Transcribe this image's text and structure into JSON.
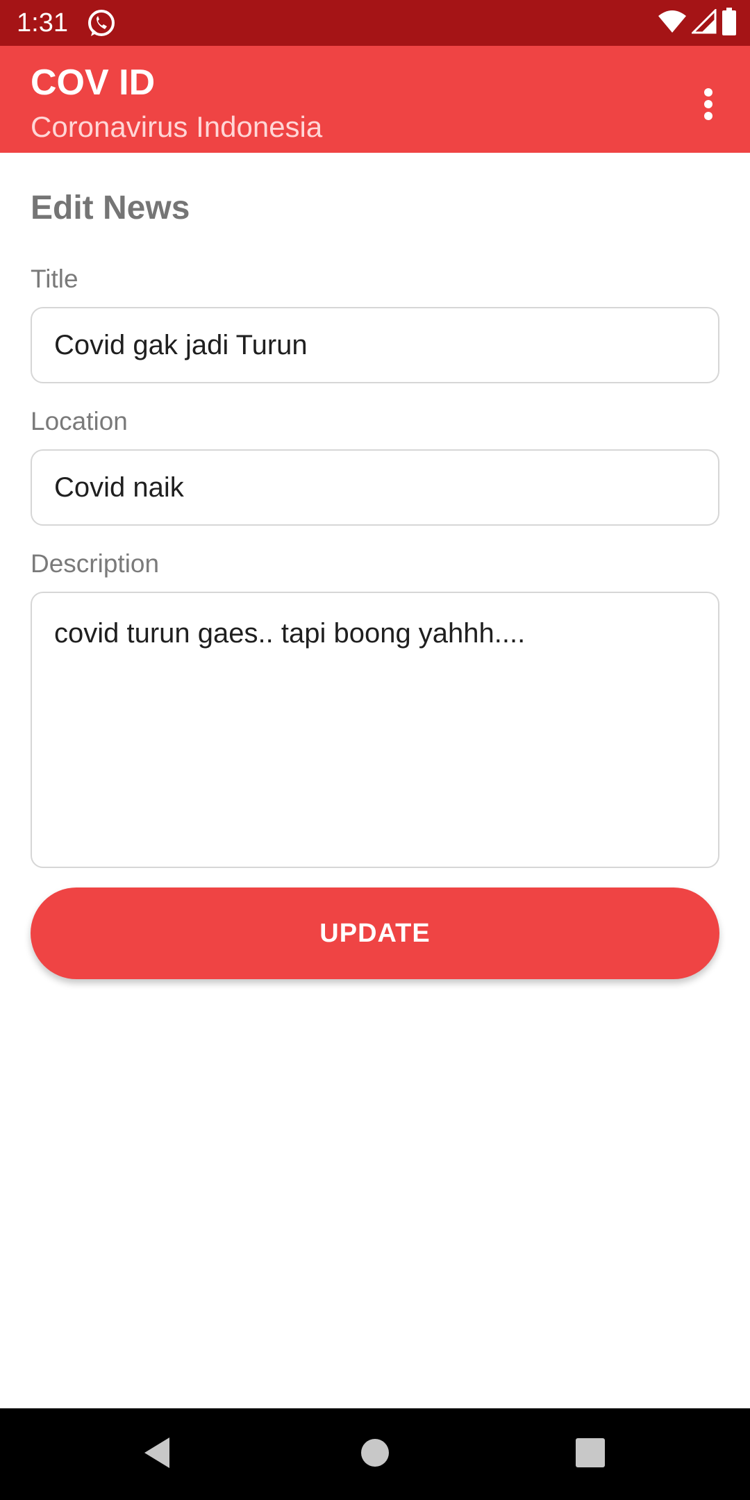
{
  "status_bar": {
    "time": "1:31",
    "notification_icon": "whatsapp-icon",
    "icons": [
      "wifi-icon",
      "signal-icon",
      "battery-icon"
    ]
  },
  "app_bar": {
    "title": "COV ID",
    "subtitle": "Coronavirus Indonesia",
    "overflow_icon": "more-vert-icon",
    "background_color": "#ef4444"
  },
  "page": {
    "heading": "Edit News"
  },
  "form": {
    "title": {
      "label": "Title",
      "value": "Covid gak jadi Turun"
    },
    "location": {
      "label": "Location",
      "value": "Covid naik"
    },
    "description": {
      "label": "Description",
      "value": "covid turun gaes.. tapi boong yahhh...."
    }
  },
  "actions": {
    "update_label": "UPDATE",
    "accent_color": "#ef4444"
  },
  "nav_bar": {
    "icons": [
      "back-icon",
      "home-icon",
      "recents-icon"
    ]
  }
}
